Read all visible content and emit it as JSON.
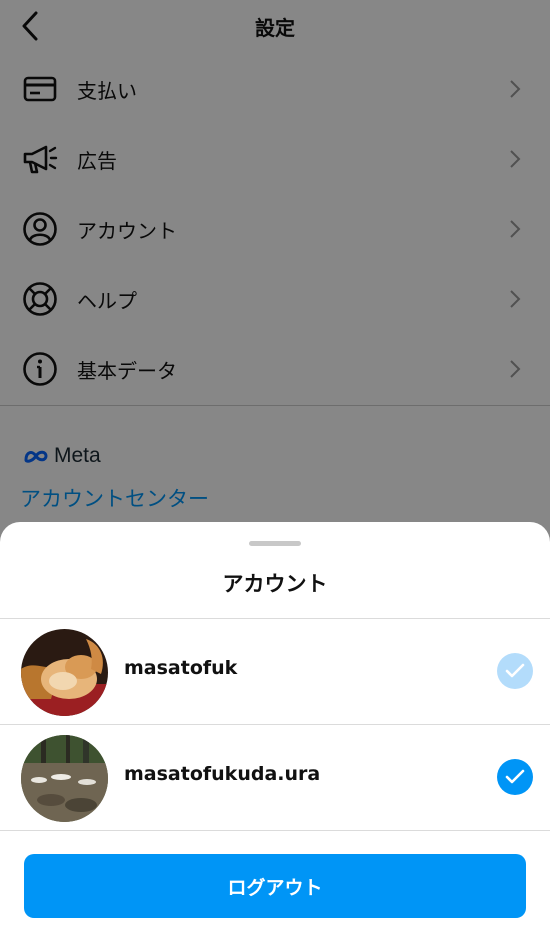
{
  "header": {
    "title": "設定"
  },
  "menu": [
    {
      "label": "支払い",
      "icon": "credit-card-icon"
    },
    {
      "label": "広告",
      "icon": "megaphone-icon"
    },
    {
      "label": "アカウント",
      "icon": "account-circle-icon"
    },
    {
      "label": "ヘルプ",
      "icon": "lifebuoy-icon"
    },
    {
      "label": "基本データ",
      "icon": "info-icon"
    }
  ],
  "meta": {
    "brand": "Meta",
    "account_center_link": "アカウントセンター"
  },
  "sheet": {
    "title": "アカウント",
    "accounts": [
      {
        "username": "masatofuk",
        "check_state": "selected-light"
      },
      {
        "username": "masatofukuda.ura",
        "check_state": "selected"
      }
    ],
    "logout_label": "ログアウト"
  },
  "colors": {
    "accent": "#0095f6",
    "accent_light": "#b3dcfb"
  }
}
